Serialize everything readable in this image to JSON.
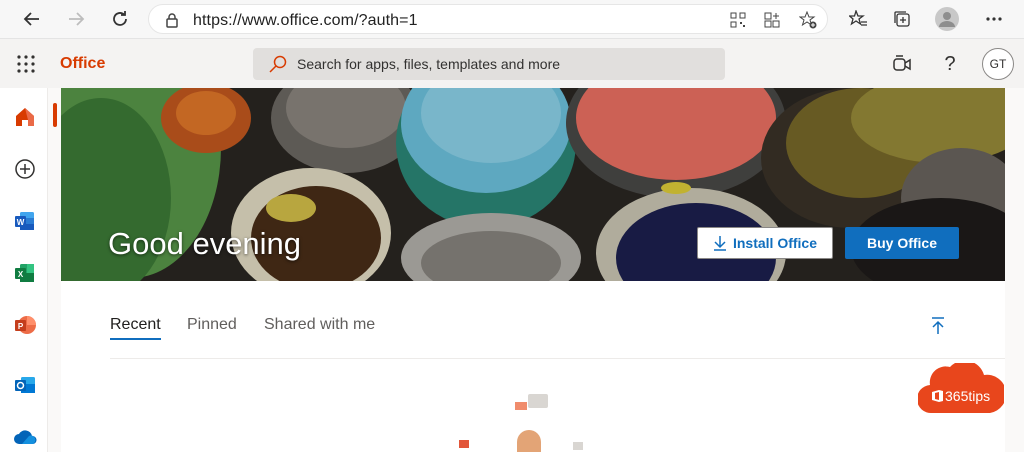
{
  "browser": {
    "url": "https://www.office.com/?auth=1"
  },
  "header": {
    "brand": "Office",
    "search_placeholder": "Search for apps, files, templates and more",
    "avatar_initials": "GT",
    "help_label": "?"
  },
  "rail": {
    "items": [
      {
        "name": "home",
        "color": "#d83b01"
      },
      {
        "name": "create",
        "color": "#323130"
      },
      {
        "name": "word",
        "color": "#2b579a"
      },
      {
        "name": "excel",
        "color": "#217346"
      },
      {
        "name": "powerpoint",
        "color": "#d24726"
      },
      {
        "name": "outlook",
        "color": "#0072c6"
      },
      {
        "name": "onedrive",
        "color": "#0364b8"
      }
    ]
  },
  "hero": {
    "greeting": "Good evening",
    "install_label": "Install Office",
    "buy_label": "Buy Office"
  },
  "tabs": [
    {
      "label": "Recent",
      "active": true
    },
    {
      "label": "Pinned",
      "active": false
    },
    {
      "label": "Shared with me",
      "active": false
    }
  ],
  "watermark": {
    "text": "365tips"
  },
  "colors": {
    "accent": "#106ebe",
    "brand": "#d83b01"
  }
}
